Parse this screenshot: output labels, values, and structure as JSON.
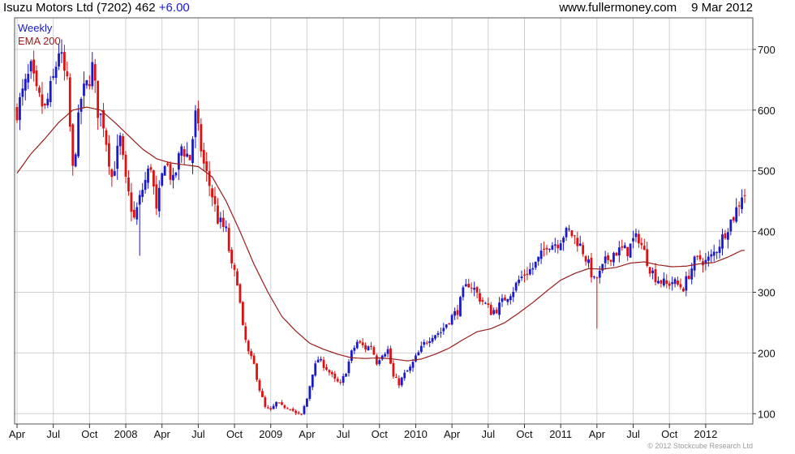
{
  "header": {
    "title": "Isuzu Motors Ltd (7202)",
    "price": "462",
    "change": "+6.00",
    "site": "www.fullermoney.com",
    "date": "9 Mar 2012"
  },
  "credit": "© 2012 Stockcube Research Ltd",
  "colors": {
    "up": "#1a1acc",
    "down": "#dd1111",
    "ema": "#9b1b1b",
    "grid": "#cfcfcf",
    "frame": "#555555"
  },
  "chart_data": {
    "type": "candlestick",
    "legend": [
      "Weekly",
      "EMA 200"
    ],
    "legend_position": "top-left",
    "y_axis_position": "right",
    "ylim": [
      83,
      752
    ],
    "xlim": [
      0,
      261
    ],
    "y_ticks": [
      100,
      200,
      300,
      400,
      500,
      600,
      700
    ],
    "x_ticks": [
      {
        "label": "Apr",
        "week": 0
      },
      {
        "label": "Jul",
        "week": 13
      },
      {
        "label": "Oct",
        "week": 26
      },
      {
        "label": "2008",
        "week": 39
      },
      {
        "label": "Apr",
        "week": 52
      },
      {
        "label": "Jul",
        "week": 65
      },
      {
        "label": "Oct",
        "week": 78
      },
      {
        "label": "2009",
        "week": 91
      },
      {
        "label": "Apr",
        "week": 104
      },
      {
        "label": "Jul",
        "week": 117
      },
      {
        "label": "Oct",
        "week": 130
      },
      {
        "label": "2010",
        "week": 143
      },
      {
        "label": "Apr",
        "week": 156
      },
      {
        "label": "Jul",
        "week": 169
      },
      {
        "label": "Oct",
        "week": 182
      },
      {
        "label": "2011",
        "week": 195
      },
      {
        "label": "Apr",
        "week": 208
      },
      {
        "label": "Jul",
        "week": 221
      },
      {
        "label": "Oct",
        "week": 234
      },
      {
        "label": "2012",
        "week": 247
      }
    ],
    "close_anchors": [
      [
        0,
        600
      ],
      [
        3,
        640
      ],
      [
        5,
        665
      ],
      [
        7,
        625
      ],
      [
        10,
        600
      ],
      [
        13,
        650
      ],
      [
        15,
        700
      ],
      [
        18,
        640
      ],
      [
        20,
        500
      ],
      [
        23,
        620
      ],
      [
        25,
        640
      ],
      [
        27,
        670
      ],
      [
        29,
        600
      ],
      [
        31,
        580
      ],
      [
        34,
        490
      ],
      [
        37,
        550
      ],
      [
        39,
        480
      ],
      [
        42,
        420
      ],
      [
        45,
        470
      ],
      [
        48,
        510
      ],
      [
        50,
        430
      ],
      [
        53,
        520
      ],
      [
        56,
        480
      ],
      [
        59,
        540
      ],
      [
        62,
        520
      ],
      [
        64,
        590
      ],
      [
        67,
        510
      ],
      [
        70,
        460
      ],
      [
        72,
        420
      ],
      [
        75,
        400
      ],
      [
        77,
        340
      ],
      [
        79,
        320
      ],
      [
        81,
        240
      ],
      [
        83,
        200
      ],
      [
        85,
        180
      ],
      [
        87,
        140
      ],
      [
        89,
        110
      ],
      [
        91,
        105
      ],
      [
        93,
        118
      ],
      [
        95,
        112
      ],
      [
        98,
        110
      ],
      [
        100,
        100
      ],
      [
        102,
        98
      ],
      [
        104,
        125
      ],
      [
        106,
        168
      ],
      [
        108,
        190
      ],
      [
        111,
        175
      ],
      [
        114,
        155
      ],
      [
        116,
        148
      ],
      [
        118,
        170
      ],
      [
        120,
        200
      ],
      [
        122,
        218
      ],
      [
        125,
        208
      ],
      [
        127,
        212
      ],
      [
        129,
        185
      ],
      [
        131,
        200
      ],
      [
        133,
        205
      ],
      [
        135,
        160
      ],
      [
        137,
        150
      ],
      [
        139,
        165
      ],
      [
        141,
        175
      ],
      [
        143,
        192
      ],
      [
        146,
        215
      ],
      [
        149,
        230
      ],
      [
        152,
        235
      ],
      [
        155,
        255
      ],
      [
        158,
        270
      ],
      [
        160,
        300
      ],
      [
        162,
        315
      ],
      [
        164,
        305
      ],
      [
        166,
        290
      ],
      [
        168,
        280
      ],
      [
        170,
        268
      ],
      [
        172,
        272
      ],
      [
        175,
        290
      ],
      [
        178,
        305
      ],
      [
        180,
        320
      ],
      [
        182,
        330
      ],
      [
        185,
        340
      ],
      [
        188,
        360
      ],
      [
        190,
        380
      ],
      [
        192,
        380
      ],
      [
        194,
        382
      ],
      [
        196,
        395
      ],
      [
        198,
        400
      ],
      [
        201,
        385
      ],
      [
        203,
        368
      ],
      [
        205,
        345
      ],
      [
        207,
        318
      ],
      [
        209,
        330
      ],
      [
        211,
        350
      ],
      [
        214,
        365
      ],
      [
        217,
        370
      ],
      [
        219,
        368
      ],
      [
        221,
        385
      ],
      [
        223,
        390
      ],
      [
        225,
        365
      ],
      [
        227,
        340
      ],
      [
        229,
        325
      ],
      [
        231,
        318
      ],
      [
        233,
        312
      ],
      [
        235,
        318
      ],
      [
        237,
        312
      ],
      [
        239,
        308
      ],
      [
        241,
        330
      ],
      [
        243,
        350
      ],
      [
        245,
        355
      ],
      [
        247,
        350
      ],
      [
        249,
        358
      ],
      [
        251,
        372
      ],
      [
        253,
        390
      ],
      [
        255,
        410
      ],
      [
        257,
        425
      ],
      [
        259,
        448
      ],
      [
        260,
        462
      ]
    ],
    "ema_200": [
      [
        0,
        496
      ],
      [
        5,
        528
      ],
      [
        10,
        553
      ],
      [
        15,
        580
      ],
      [
        20,
        600
      ],
      [
        25,
        605
      ],
      [
        30,
        600
      ],
      [
        35,
        580
      ],
      [
        40,
        558
      ],
      [
        45,
        536
      ],
      [
        50,
        520
      ],
      [
        55,
        513
      ],
      [
        60,
        510
      ],
      [
        65,
        507
      ],
      [
        70,
        490
      ],
      [
        75,
        450
      ],
      [
        80,
        400
      ],
      [
        85,
        346
      ],
      [
        90,
        300
      ],
      [
        95,
        260
      ],
      [
        100,
        236
      ],
      [
        105,
        216
      ],
      [
        110,
        206
      ],
      [
        115,
        198
      ],
      [
        120,
        192
      ],
      [
        125,
        191
      ],
      [
        130,
        192
      ],
      [
        135,
        190
      ],
      [
        140,
        187
      ],
      [
        145,
        190
      ],
      [
        150,
        198
      ],
      [
        155,
        208
      ],
      [
        160,
        222
      ],
      [
        165,
        235
      ],
      [
        170,
        240
      ],
      [
        175,
        250
      ],
      [
        180,
        266
      ],
      [
        185,
        283
      ],
      [
        190,
        302
      ],
      [
        195,
        320
      ],
      [
        200,
        331
      ],
      [
        205,
        339
      ],
      [
        210,
        338
      ],
      [
        215,
        341
      ],
      [
        220,
        348
      ],
      [
        225,
        350
      ],
      [
        230,
        345
      ],
      [
        235,
        342
      ],
      [
        240,
        343
      ],
      [
        245,
        347
      ],
      [
        250,
        349
      ],
      [
        255,
        358
      ],
      [
        260,
        369
      ]
    ],
    "spikes": [
      {
        "week": 208,
        "low": 240
      },
      {
        "week": 20,
        "low": 492
      },
      {
        "week": 44,
        "low": 360
      }
    ]
  }
}
